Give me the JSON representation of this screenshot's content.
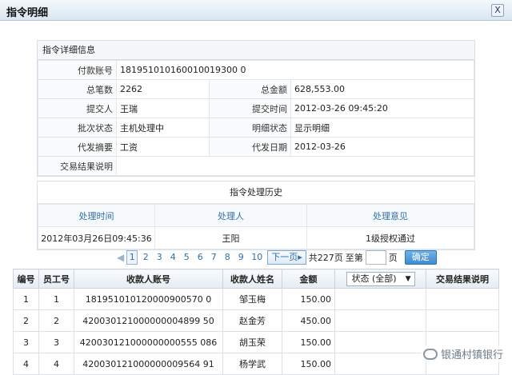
{
  "window": {
    "title": "指令明细",
    "close_glyph": "X"
  },
  "detail": {
    "header": "指令详细信息",
    "account_label": "付款账号",
    "account_value": "181951010160010019300 0",
    "count_label": "总笔数",
    "count_value": "2262",
    "amount_label": "总金额",
    "amount_value": "628,553.00",
    "submitter_label": "提交人",
    "submitter_value": "王瑞",
    "submit_time_label": "提交时间",
    "submit_time_value": "2012-03-26 09:45:20",
    "batch_status_label": "批次状态",
    "batch_status_value": "主机处理中",
    "detail_status_label": "明细状态",
    "detail_status_value": "显示明细",
    "summary_label": "代发摘要",
    "summary_value": "工资",
    "date_label": "代发日期",
    "date_value": "2012-03-26",
    "result_label": "交易结果说明",
    "result_value": ""
  },
  "history": {
    "caption": "指令处理历史",
    "headers": [
      "处理时间",
      "处理人",
      "处理意见"
    ],
    "rows": [
      [
        "2012年03月26日09:45:36",
        "王阳",
        "1级授权通过"
      ]
    ]
  },
  "pager": {
    "pages": [
      "1",
      "2",
      "3",
      "4",
      "5",
      "6",
      "7",
      "8",
      "9",
      "10"
    ],
    "current": "1",
    "next_label": "下一页",
    "total_label": "共227页",
    "goto_label": "至第",
    "page_unit": "页",
    "page_input_value": "",
    "confirm_label": "确定"
  },
  "grid": {
    "headers": [
      "编号",
      "员工号",
      "收款人账号",
      "收款人姓名",
      "金额",
      "",
      "交易结果说明"
    ],
    "status_filter": "状态 (全部)",
    "rows": [
      [
        "1",
        "1",
        "181951010120000900570 0",
        "邹玉梅",
        "150.00",
        "",
        ""
      ],
      [
        "2",
        "2",
        "420030121000000004899 50",
        "赵金芳",
        "450.00",
        "",
        ""
      ],
      [
        "3",
        "3",
        "420030121000000000555 086",
        "胡玉荣",
        "150.00",
        "",
        ""
      ],
      [
        "4",
        "4",
        "420030121000000009564 91",
        "杨学武",
        "150.00",
        "",
        ""
      ]
    ]
  },
  "watermark": {
    "text": "银通村镇银行"
  },
  "colors": {
    "accent": "#2f6fa8",
    "confirm_button": "#3d8bd0"
  }
}
